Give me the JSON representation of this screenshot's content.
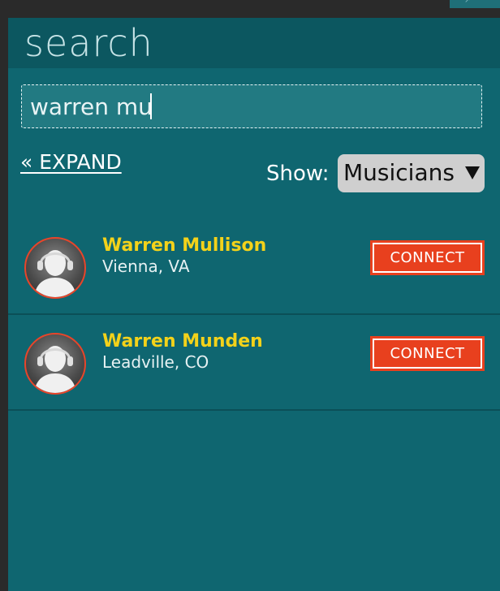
{
  "panel": {
    "title": "search"
  },
  "search": {
    "value": "warren mu"
  },
  "controls": {
    "expand_label": "« EXPAND",
    "show_label": "Show:",
    "show_selected": "Musicians"
  },
  "results": [
    {
      "name": "Warren Mullison",
      "location": "Vienna, VA",
      "connect_label": "CONNECT",
      "avatar_icon": "musician-headphones-avatar"
    },
    {
      "name": "Warren Munden",
      "location": "Leadville, CO",
      "connect_label": "CONNECT",
      "avatar_icon": "musician-headphones-avatar"
    }
  ],
  "colors": {
    "panel_bg": "#0f6670",
    "header_bg": "#0c5760",
    "accent_name": "#f3d21a",
    "connect_button": "#e8401e"
  }
}
